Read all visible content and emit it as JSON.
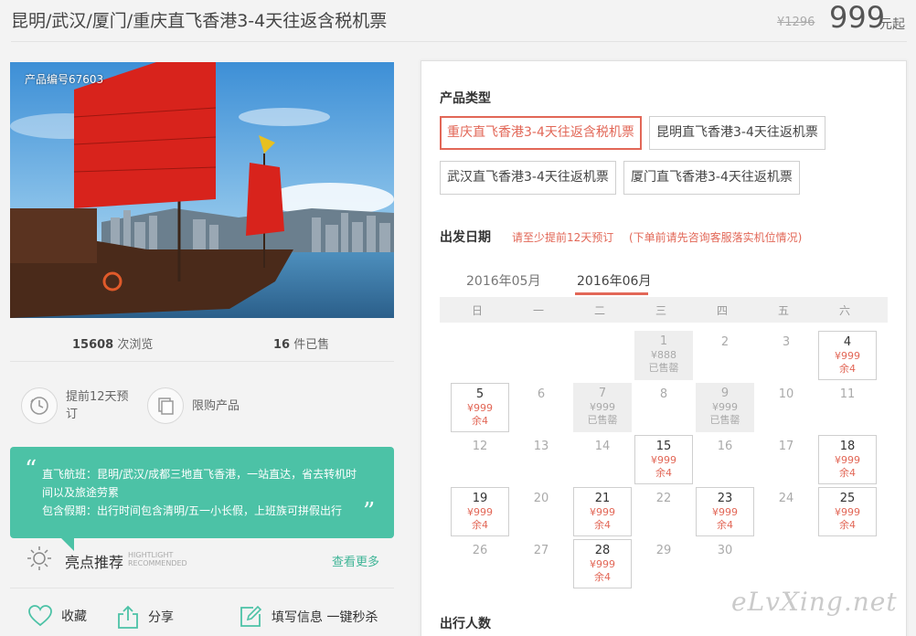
{
  "header": {
    "title": "昆明/武汉/厦门/重庆直飞香港3-4天往返含税机票",
    "old_price": "¥1296",
    "price": "999",
    "price_unit": "元起"
  },
  "hero": {
    "product_no": "产品编号67603"
  },
  "stats": {
    "views_count": "15608",
    "views_label": "次浏览",
    "sold_count": "16",
    "sold_label": "件已售"
  },
  "features": [
    {
      "icon": "clock-icon",
      "label": "提前12天预订"
    },
    {
      "icon": "pages-icon",
      "label": "限购产品"
    }
  ],
  "highlight_bubble": {
    "lines": [
      "直飞航班：昆明/武汉/成都三地直飞香港，一站直达，省去转机时间以及旅途劳累",
      "包含假期：出行时间包含清明/五一小长假，上班族可拼假出行"
    ]
  },
  "highlight": {
    "title": "亮点推荐",
    "en_1": "HIGHTLIGHT",
    "en_2": "RECOMMENDED",
    "more": "查看更多"
  },
  "actions": [
    {
      "icon": "heart-icon",
      "label": "收藏"
    },
    {
      "icon": "share-icon",
      "label": "分享"
    },
    {
      "icon": "edit-icon",
      "label": "填写信息 一键秒杀"
    }
  ],
  "product_type": {
    "title": "产品类型",
    "options": [
      "重庆直飞香港3-4天往返含税机票",
      "昆明直飞香港3-4天往返机票",
      "武汉直飞香港3-4天往返机票",
      "厦门直飞香港3-4天往返机票"
    ],
    "selected_index": 0
  },
  "departure": {
    "title": "出发日期",
    "note1": "请至少提前12天预订",
    "note2": "(下单前请先咨询客服落实机位情况)"
  },
  "calendar": {
    "months": [
      "2016年05月",
      "2016年06月"
    ],
    "active_month_index": 1,
    "weekdays": [
      "日",
      "一",
      "二",
      "三",
      "四",
      "五",
      "六"
    ],
    "days": [
      {
        "d": "1",
        "col": 3,
        "row": 0,
        "status": "sold",
        "price": "¥888",
        "remain": "已售罄"
      },
      {
        "d": "2",
        "col": 4,
        "row": 0,
        "status": "empty"
      },
      {
        "d": "3",
        "col": 5,
        "row": 0,
        "status": "empty"
      },
      {
        "d": "4",
        "col": 6,
        "row": 0,
        "status": "avail",
        "price": "¥999",
        "remain": "余4"
      },
      {
        "d": "5",
        "col": 0,
        "row": 1,
        "status": "avail",
        "price": "¥999",
        "remain": "余4"
      },
      {
        "d": "6",
        "col": 1,
        "row": 1,
        "status": "empty"
      },
      {
        "d": "7",
        "col": 2,
        "row": 1,
        "status": "sold",
        "price": "¥999",
        "remain": "已售罄"
      },
      {
        "d": "8",
        "col": 3,
        "row": 1,
        "status": "empty"
      },
      {
        "d": "9",
        "col": 4,
        "row": 1,
        "status": "sold",
        "price": "¥999",
        "remain": "已售罄"
      },
      {
        "d": "10",
        "col": 5,
        "row": 1,
        "status": "empty"
      },
      {
        "d": "11",
        "col": 6,
        "row": 1,
        "status": "empty"
      },
      {
        "d": "12",
        "col": 0,
        "row": 2,
        "status": "empty"
      },
      {
        "d": "13",
        "col": 1,
        "row": 2,
        "status": "empty"
      },
      {
        "d": "14",
        "col": 2,
        "row": 2,
        "status": "empty"
      },
      {
        "d": "15",
        "col": 3,
        "row": 2,
        "status": "avail",
        "price": "¥999",
        "remain": "余4"
      },
      {
        "d": "16",
        "col": 4,
        "row": 2,
        "status": "empty"
      },
      {
        "d": "17",
        "col": 5,
        "row": 2,
        "status": "empty"
      },
      {
        "d": "18",
        "col": 6,
        "row": 2,
        "status": "avail",
        "price": "¥999",
        "remain": "余4"
      },
      {
        "d": "19",
        "col": 0,
        "row": 3,
        "status": "avail",
        "price": "¥999",
        "remain": "余4"
      },
      {
        "d": "20",
        "col": 1,
        "row": 3,
        "status": "empty"
      },
      {
        "d": "21",
        "col": 2,
        "row": 3,
        "status": "avail",
        "price": "¥999",
        "remain": "余4"
      },
      {
        "d": "22",
        "col": 3,
        "row": 3,
        "status": "empty"
      },
      {
        "d": "23",
        "col": 4,
        "row": 3,
        "status": "avail",
        "price": "¥999",
        "remain": "余4"
      },
      {
        "d": "24",
        "col": 5,
        "row": 3,
        "status": "empty"
      },
      {
        "d": "25",
        "col": 6,
        "row": 3,
        "status": "avail",
        "price": "¥999",
        "remain": "余4"
      },
      {
        "d": "26",
        "col": 0,
        "row": 4,
        "status": "empty"
      },
      {
        "d": "27",
        "col": 1,
        "row": 4,
        "status": "empty"
      },
      {
        "d": "28",
        "col": 2,
        "row": 4,
        "status": "avail",
        "price": "¥999",
        "remain": "余4"
      },
      {
        "d": "29",
        "col": 3,
        "row": 4,
        "status": "empty"
      },
      {
        "d": "30",
        "col": 4,
        "row": 4,
        "status": "empty"
      }
    ]
  },
  "travelers": {
    "title": "出行人数"
  },
  "watermark": "eLvXing.net",
  "colors": {
    "accent": "#e26757",
    "green": "#4cc2a6"
  }
}
